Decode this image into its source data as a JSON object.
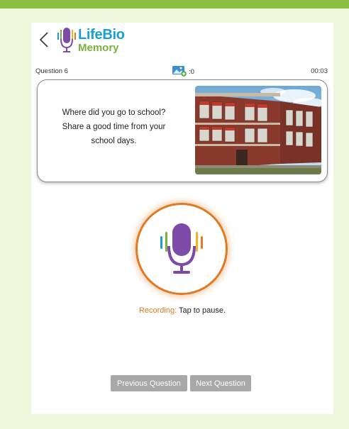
{
  "header": {
    "back_icon": "chevron-left-icon",
    "logo": {
      "brand": "LifeBio",
      "sub": "Memory",
      "icon": "microphone-icon"
    }
  },
  "meta": {
    "question_label": "Question 6",
    "photo_count": ":0",
    "photo_icon": "add-photo-icon",
    "timer": "00:03"
  },
  "question": {
    "lines": [
      "Where did you go to school?",
      "Share a good time from your",
      "school days."
    ],
    "image": "school-building-photo"
  },
  "recorder": {
    "icon": "microphone-icon",
    "status_label": "Recording:",
    "status_hint": "Tap to pause.",
    "accent": "#e07a23",
    "mic_color": "#7e4aa8"
  },
  "nav": {
    "previous": "Previous Question",
    "next": "Next Question"
  },
  "colors": {
    "brand_blue": "#1a9fd4",
    "brand_green": "#7bb23a",
    "page_bg": "#eef7dc",
    "top_bar": "#8bbd3f"
  }
}
